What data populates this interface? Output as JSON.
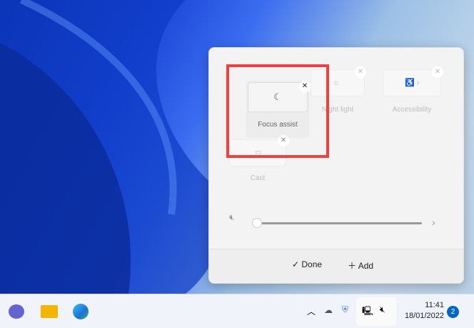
{
  "panel": {
    "tiles": [
      {
        "label": "Focus assist",
        "icon": "moon-icon"
      },
      {
        "label": "Night light",
        "icon": "sun-icon"
      },
      {
        "label": "Accessibility",
        "icon": "accessibility-icon"
      },
      {
        "label": "Cast",
        "icon": "cast-icon"
      }
    ],
    "volume": {
      "level": 0,
      "icon": "speaker-muted-icon"
    },
    "done_label": "Done",
    "add_label": "Add"
  },
  "taskbar": {
    "time": "11:41",
    "date": "18/01/2022",
    "notifications": "2"
  },
  "colors": {
    "highlight": "#f04040",
    "accent": "#0067c0"
  }
}
